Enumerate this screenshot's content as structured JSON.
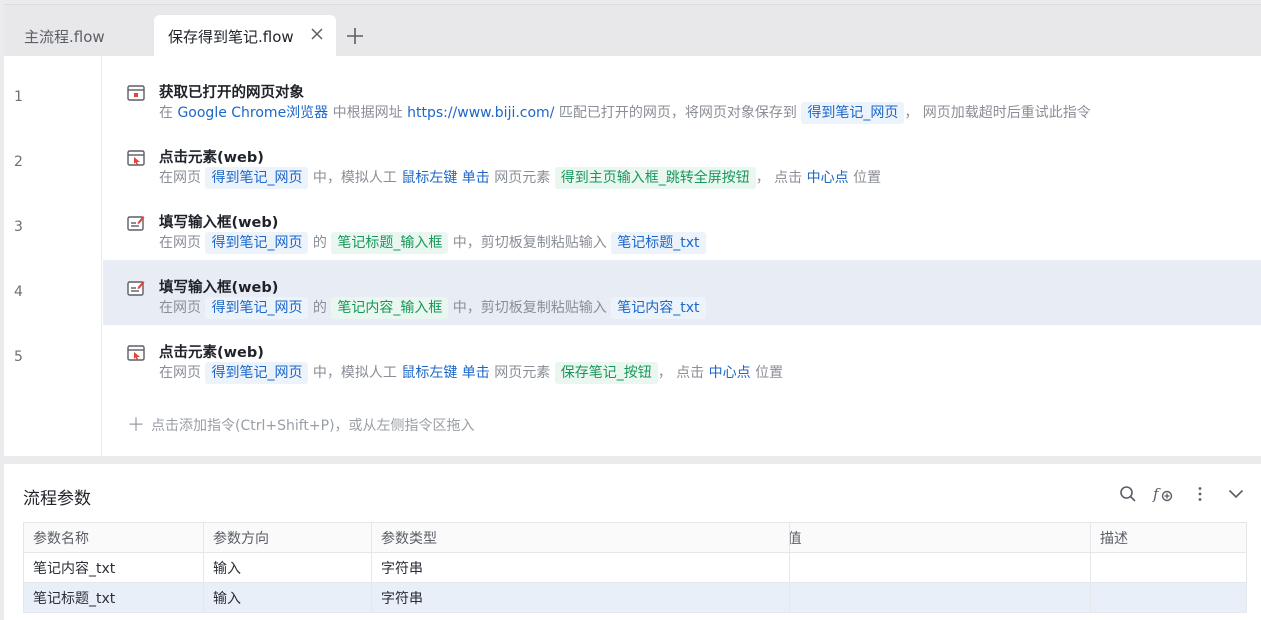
{
  "tabs": [
    {
      "label": "主流程.flow",
      "active": false
    },
    {
      "label": "保存得到笔记.flow",
      "active": true
    }
  ],
  "steps": [
    {
      "line": "1",
      "title": "获取已打开的网页对象",
      "icon": "browser-window-icon",
      "desc": [
        {
          "t": "在 ",
          "k": "text"
        },
        {
          "t": "Google Chrome浏览器",
          "k": "link"
        },
        {
          "t": " 中根据网址 ",
          "k": "text"
        },
        {
          "t": "https://www.biji.com/",
          "k": "link"
        },
        {
          "t": " 匹配已打开的网页，将网页对象保存到 ",
          "k": "text"
        },
        {
          "t": "得到笔记_网页",
          "k": "var"
        },
        {
          "t": "， 网页加载超时后重试此指令",
          "k": "text"
        }
      ]
    },
    {
      "line": "2",
      "title": "点击元素(web)",
      "icon": "click-element-icon",
      "desc": [
        {
          "t": "在网页 ",
          "k": "text"
        },
        {
          "t": "得到笔记_网页",
          "k": "var"
        },
        {
          "t": " 中，模拟人工 ",
          "k": "text"
        },
        {
          "t": "鼠标左键 单击",
          "k": "link"
        },
        {
          "t": " 网页元素 ",
          "k": "text"
        },
        {
          "t": "得到主页输入框_跳转全屏按钮",
          "k": "el"
        },
        {
          "t": "， 点击 ",
          "k": "text"
        },
        {
          "t": "中心点",
          "k": "link"
        },
        {
          "t": " 位置",
          "k": "text"
        }
      ]
    },
    {
      "line": "3",
      "title": "填写输入框(web)",
      "icon": "fill-input-icon",
      "desc": [
        {
          "t": "在网页 ",
          "k": "text"
        },
        {
          "t": "得到笔记_网页",
          "k": "var"
        },
        {
          "t": " 的 ",
          "k": "text"
        },
        {
          "t": "笔记标题_输入框",
          "k": "el"
        },
        {
          "t": " 中，剪切板复制粘贴输入 ",
          "k": "text"
        },
        {
          "t": "笔记标题_txt",
          "k": "var"
        }
      ]
    },
    {
      "line": "4",
      "title": "填写输入框(web)",
      "icon": "fill-input-icon",
      "selected": true,
      "desc": [
        {
          "t": "在网页 ",
          "k": "text"
        },
        {
          "t": "得到笔记_网页",
          "k": "var"
        },
        {
          "t": " 的 ",
          "k": "text"
        },
        {
          "t": "笔记内容_输入框",
          "k": "el"
        },
        {
          "t": " 中，剪切板复制粘贴输入 ",
          "k": "text"
        },
        {
          "t": "笔记内容_txt",
          "k": "var"
        }
      ]
    },
    {
      "line": "5",
      "title": "点击元素(web)",
      "icon": "click-element-icon",
      "desc": [
        {
          "t": "在网页 ",
          "k": "text"
        },
        {
          "t": "得到笔记_网页",
          "k": "var"
        },
        {
          "t": " 中，模拟人工 ",
          "k": "text"
        },
        {
          "t": "鼠标左键 单击",
          "k": "link"
        },
        {
          "t": " 网页元素 ",
          "k": "text"
        },
        {
          "t": "保存笔记_按钮",
          "k": "el"
        },
        {
          "t": "， 点击 ",
          "k": "text"
        },
        {
          "t": "中心点",
          "k": "link"
        },
        {
          "t": " 位置",
          "k": "text"
        }
      ]
    }
  ],
  "add_command_hint": "点击添加指令(Ctrl+Shift+P)，或从左侧指令区拖入",
  "params": {
    "title": "流程参数",
    "columns": [
      "参数名称",
      "参数方向",
      "参数类型",
      "默认值",
      "描述"
    ],
    "rows": [
      {
        "name": "笔记内容_txt",
        "direction": "输入",
        "type": "字符串",
        "default": "",
        "desc": ""
      },
      {
        "name": "笔记标题_txt",
        "direction": "输入",
        "type": "字符串",
        "default": "",
        "desc": "",
        "selected": true
      }
    ]
  },
  "colors": {
    "link": "#1c67c8",
    "variable_bg": "#edf3fb",
    "element_bg": "#eaf7f0",
    "element_text": "#17985a",
    "selected_row": "#e8edf5"
  }
}
